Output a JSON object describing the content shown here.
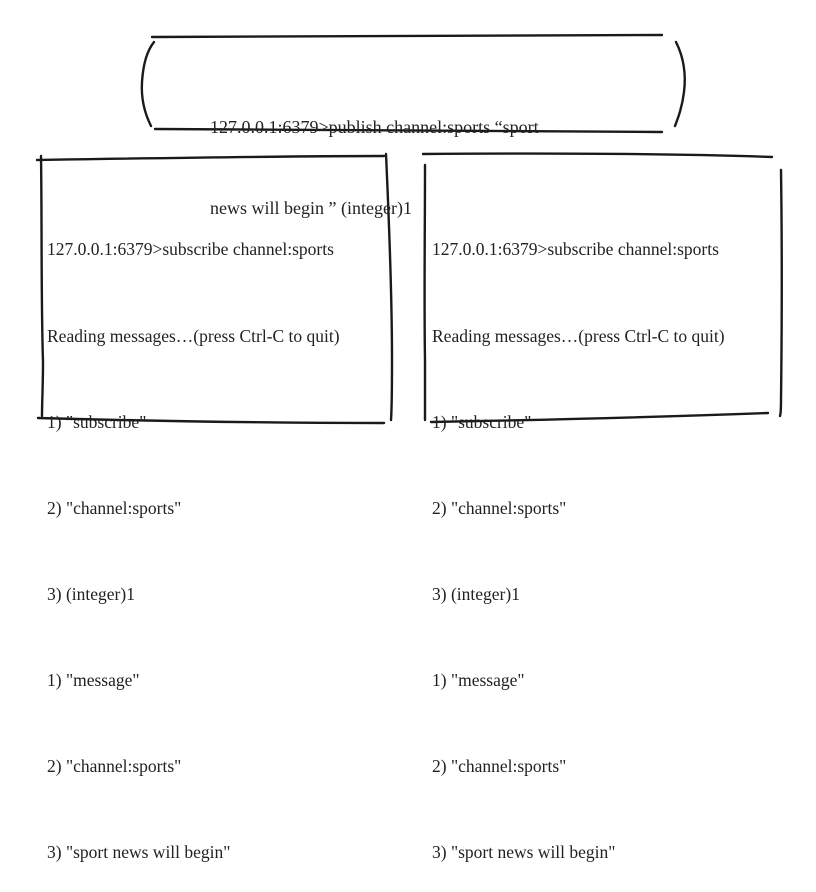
{
  "publisher": {
    "lines": [
      "127.0.0.1:6379>publish channel:sports “sport",
      "news will begin ” (integer)1"
    ]
  },
  "subscribers": [
    {
      "lines": [
        "127.0.0.1:6379>subscribe channel:sports",
        "Reading messages…(press Ctrl-C to quit)",
        "1) \"subscribe\"",
        "2) \"channel:sports\"",
        "3) (integer)1",
        "1) \"message\"",
        "2) \"channel:sports\"",
        "3) \"sport news will begin\""
      ]
    },
    {
      "lines": [
        "127.0.0.1:6379>subscribe channel:sports",
        "Reading messages…(press Ctrl-C to quit)",
        "1) \"subscribe\"",
        "2) \"channel:sports\"",
        "3) (integer)1",
        "1) \"message\"",
        "2) \"channel:sports\"",
        "3) \"sport news will begin\""
      ]
    }
  ],
  "colors": {
    "ink": "#1a1a1a",
    "text": "#222222",
    "background": "#ffffff"
  }
}
